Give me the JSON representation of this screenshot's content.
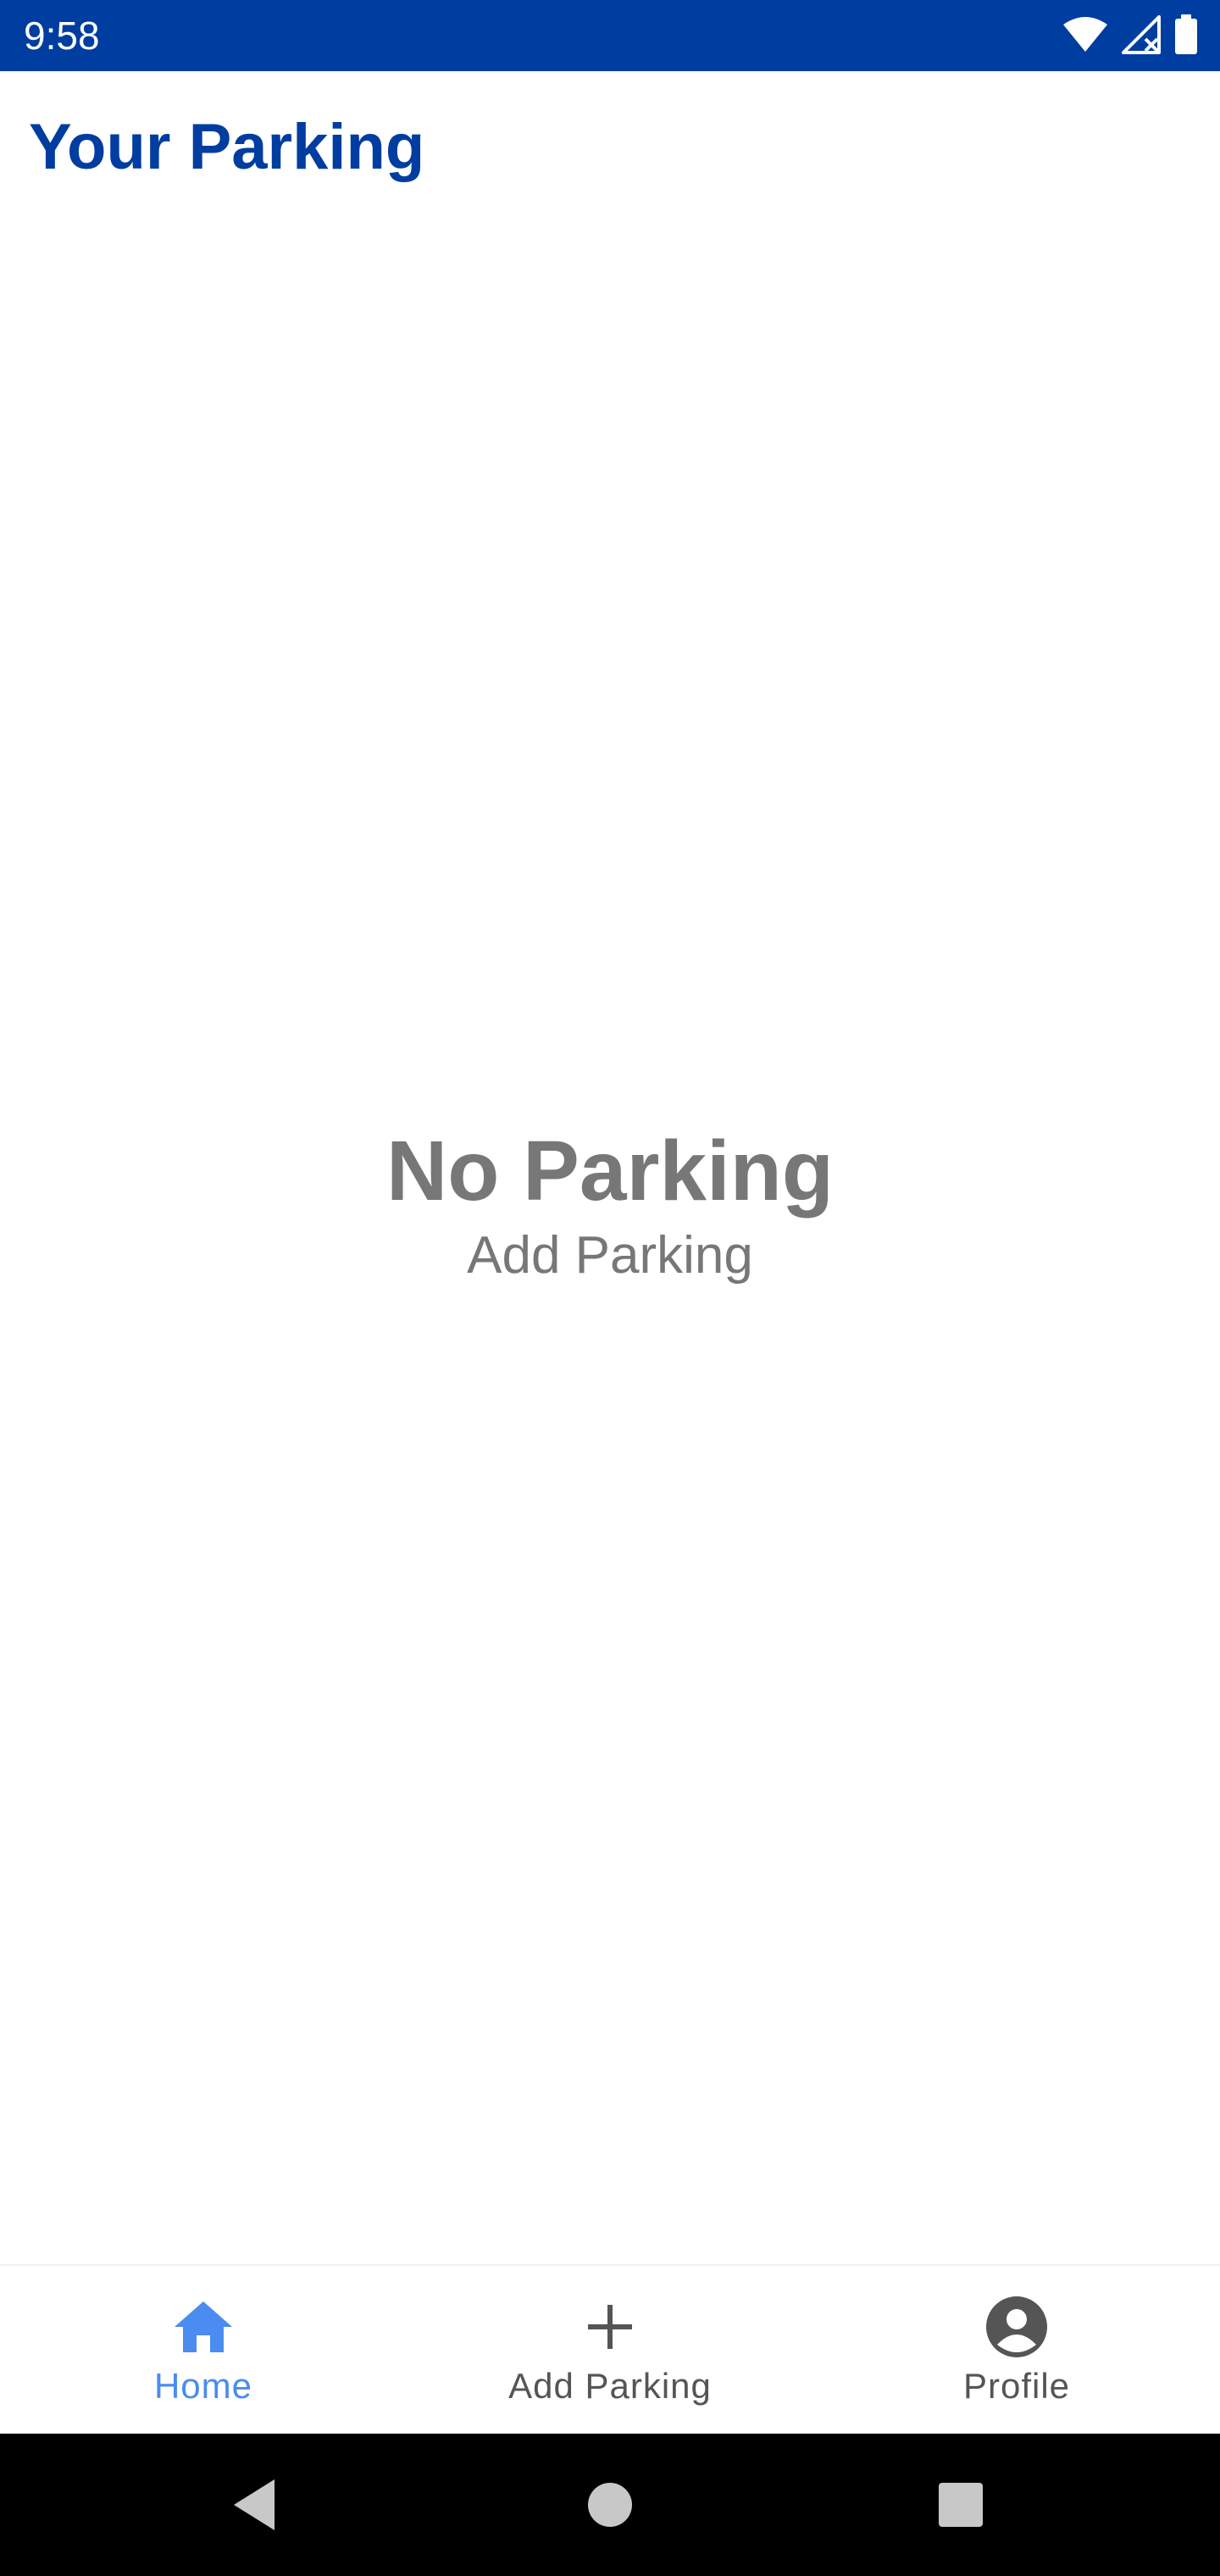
{
  "status_bar": {
    "time": "9:58",
    "icons": [
      "wifi-icon",
      "signal-icon",
      "battery-icon"
    ]
  },
  "header": {
    "title": "Your Parking"
  },
  "empty_state": {
    "title": "No Parking",
    "action_label": "Add Parking"
  },
  "bottom_nav": {
    "items": [
      {
        "label": "Home",
        "icon": "home-icon",
        "active": true
      },
      {
        "label": "Add Parking",
        "icon": "plus-icon",
        "active": false
      },
      {
        "label": "Profile",
        "icon": "account-circle-icon",
        "active": false
      }
    ]
  },
  "colors": {
    "primary": "#003DA0",
    "active_nav": "#4A8CF0",
    "muted_text": "#777777",
    "nav_text": "#555555"
  },
  "system_nav": {
    "buttons": [
      "back-icon",
      "home-circle-icon",
      "recents-icon"
    ]
  }
}
